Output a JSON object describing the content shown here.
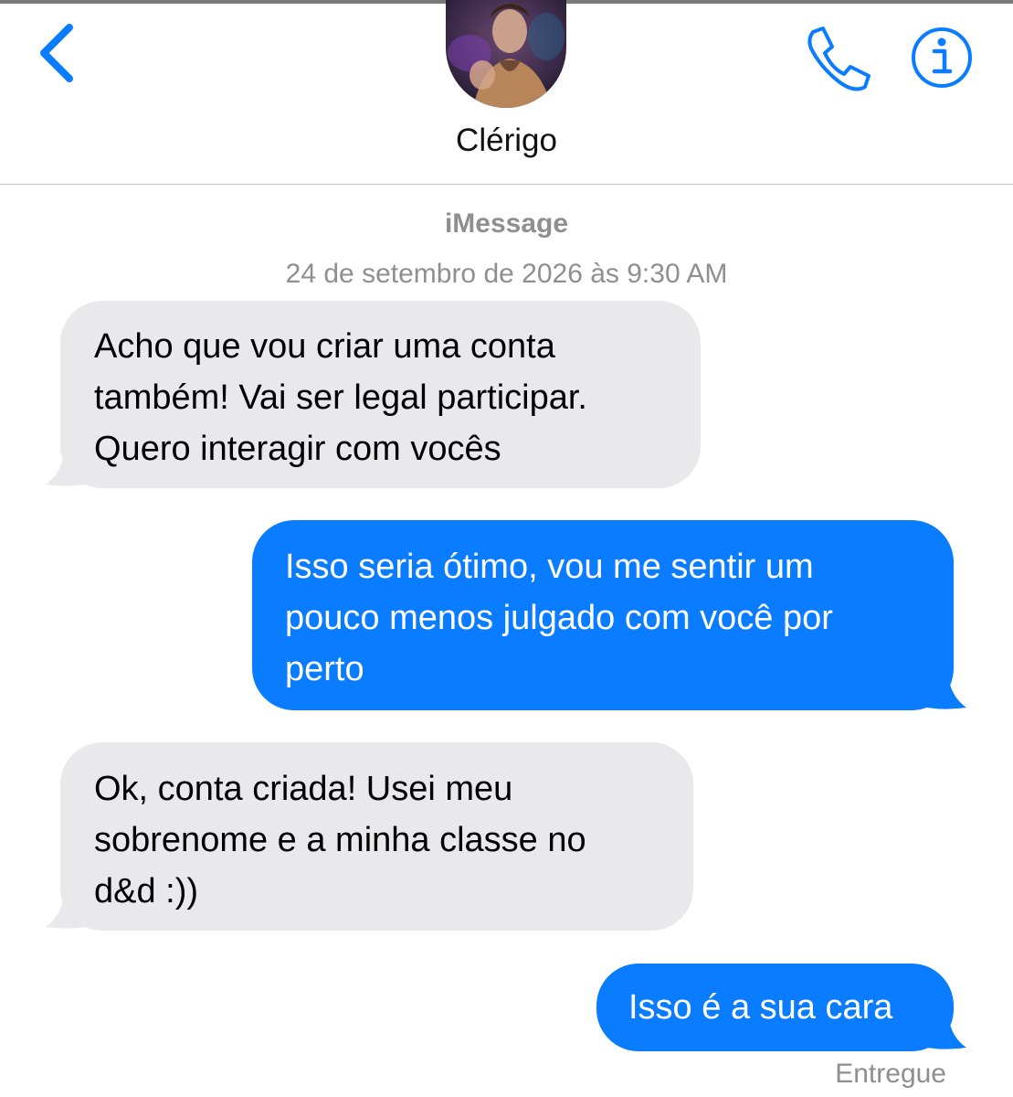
{
  "header": {
    "back_icon": "chevron-left-icon",
    "contact_name": "Clérigo",
    "phone_icon": "phone-icon",
    "info_icon": "info-icon",
    "accent_color": "#0a7cff"
  },
  "thread": {
    "service_label": "iMessage",
    "timestamp": "24 de setembro de 2026 às 9:30 AM",
    "messages": [
      {
        "direction": "incoming",
        "lines": [
          "Acho que vou criar uma conta",
          "também! Vai ser legal participar.",
          "Quero interagir com vocês"
        ]
      },
      {
        "direction": "outgoing",
        "lines": [
          "Isso seria ótimo, vou me sentir um",
          "pouco menos julgado com você por",
          "perto"
        ]
      },
      {
        "direction": "incoming",
        "lines": [
          "Ok, conta criada! Usei meu",
          "sobrenome e a minha classe no",
          "d&d :))"
        ]
      },
      {
        "direction": "outgoing",
        "lines": [
          "Isso é a sua cara"
        ]
      }
    ],
    "delivery_status": "Entregue",
    "incoming_bubble_color": "#e9e9eb",
    "outgoing_bubble_color": "#0a7cff"
  }
}
